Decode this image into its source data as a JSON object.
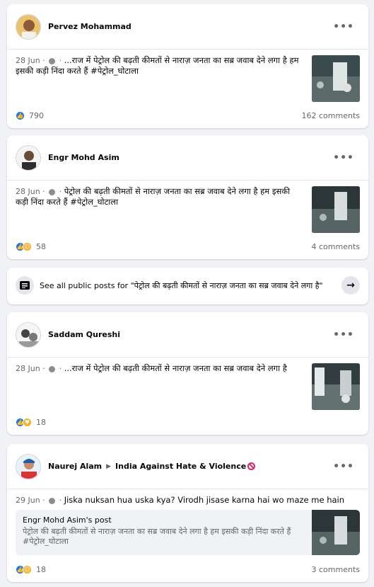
{
  "posts": [
    {
      "author": "Pervez Mohammad",
      "date": "28 Jun",
      "text": "...राज में पेट्रोल की बढ़ती कीमतों से नाराज़ जनता का सब्र जवाब देने लगा है हम इसकी कड़ी निंदा करते हैं #पेट्रोल_घोटाला",
      "reaction_count": "790",
      "comments": "162 comments"
    },
    {
      "author": "Engr Mohd Asim",
      "date": "28 Jun",
      "text": "पेट्रोल की बढ़ती कीमतों से नाराज़ जनता का सब्र जवाब देने लगा है हम इसकी कड़ी निंदा करते हैं #पेट्रोल_घोटाला",
      "reaction_count": "58",
      "comments": "4 comments"
    },
    {
      "author": "Saddam Qureshi",
      "date": "28 Jun",
      "text": "...राज में पेट्रोल की बढ़ती कीमतों से नाराज़ जनता का सब्र जवाब देने लगा है",
      "reaction_count": "18",
      "comments": ""
    },
    {
      "author": "Naurej Alam",
      "group": "India Against Hate & Violence",
      "date": "29 Jun",
      "text": "Jiska nuksan hua uska kya? Virodh jisase karna hai wo maze me hain",
      "shared_title": "Engr Mohd Asim's post",
      "shared_text": "पेट्रोल की बढ़ती कीमतों से नाराज़ जनता का सब्र जवाब देने लगा है हम इसकी कड़ी निंदा करते हैं #पेट्रोल_घोटाला",
      "reaction_count": "18",
      "comments": "3 comments"
    }
  ],
  "see_all": {
    "text": "See all public posts for \"पेट्रोल की बढ़ती कीमतों से नाराज़ जनता का सब्र जवाब देने लगा है\""
  },
  "icons": {
    "more": "more-options-icon",
    "globe": "globe-icon",
    "like": "like-reaction-icon",
    "sad": "sad-reaction-icon",
    "care": "care-reaction-icon",
    "arrow": "arrow-right-icon",
    "posts": "posts-list-icon"
  },
  "colors": {
    "background": "#f0f2f5",
    "like_blue": "#1877f2",
    "meta_grey": "#65676b"
  },
  "more_glyph": "•••",
  "arrow_glyph": "→"
}
